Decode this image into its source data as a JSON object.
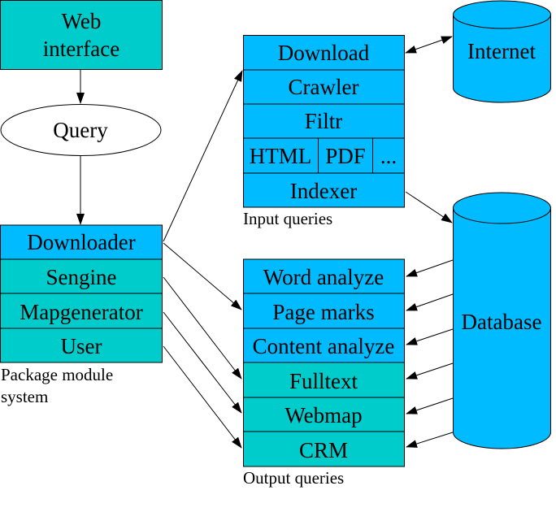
{
  "colors": {
    "teal": "#00CCCC",
    "blue": "#00BBFF"
  },
  "web_interface": {
    "line1": "Web",
    "line2": "interface"
  },
  "query": "Query",
  "package": {
    "items": [
      "Downloader",
      "Sengine",
      "Mapgenerator",
      "User"
    ],
    "caption_line1": "Package module",
    "caption_line2": "system"
  },
  "input": {
    "items": [
      "Download",
      "Crawler",
      "Filtr"
    ],
    "formats": [
      "HTML",
      "PDF",
      "..."
    ],
    "indexer": "Indexer",
    "caption": "Input queries"
  },
  "output": {
    "items": [
      "Word analyze",
      "Page marks",
      "Content analyze",
      "Fulltext",
      "Webmap",
      "CRM"
    ],
    "caption": "Output queries"
  },
  "internet": "Internet",
  "database": "Database"
}
